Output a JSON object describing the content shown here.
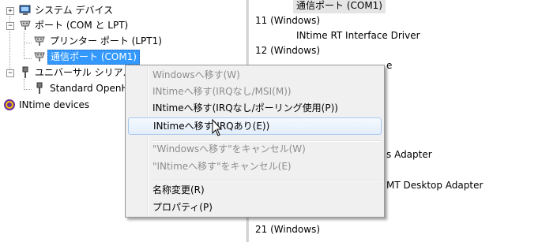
{
  "tree": {
    "items": [
      {
        "label": "システム デバイス",
        "expander": "+"
      },
      {
        "label": "ポート (COM と LPT)",
        "expander": "−"
      },
      {
        "label": "プリンター ポート (LPT1)"
      },
      {
        "label": "通信ポート (COM1)"
      },
      {
        "label": "ユニバーサル シリアル",
        "expander": "−"
      },
      {
        "label": "Standard OpenH"
      },
      {
        "label": "INtime devices"
      }
    ]
  },
  "right_pane": {
    "rows": [
      {
        "text": "通信ポート (COM1)"
      },
      {
        "text": "11 (Windows)"
      },
      {
        "text": "INtime RT Interface Driver"
      },
      {
        "text": "12 (Windows)"
      },
      {
        "text": "e"
      },
      {
        "text": "s Adapter"
      },
      {
        "text": "MT Desktop Adapter"
      },
      {
        "text": "21 (Windows)"
      }
    ]
  },
  "context_menu": {
    "items": [
      {
        "label": "Windowsへ移す(W)",
        "enabled": false
      },
      {
        "label": "INtimeへ移す(IRQなし/MSI(M))",
        "enabled": false
      },
      {
        "label": "INtimeへ移す(IRQなし/ポーリング使用(P))",
        "enabled": true
      },
      {
        "label": "INtimeへ移す(IRQあり(E))",
        "enabled": true,
        "hovered": true
      },
      {
        "label": "\"Windowsへ移す\"をキャンセル(W)",
        "enabled": false
      },
      {
        "label": "\"INtimeへ移す\"をキャンセル(E)",
        "enabled": false
      },
      {
        "label": "名称変更(R)",
        "enabled": true
      },
      {
        "label": "プロパティ(P)",
        "enabled": true
      }
    ]
  },
  "colors": {
    "selection": "#3399ff",
    "menu_bg": "#f0f0f0",
    "disabled_text": "#8d8d8d"
  }
}
